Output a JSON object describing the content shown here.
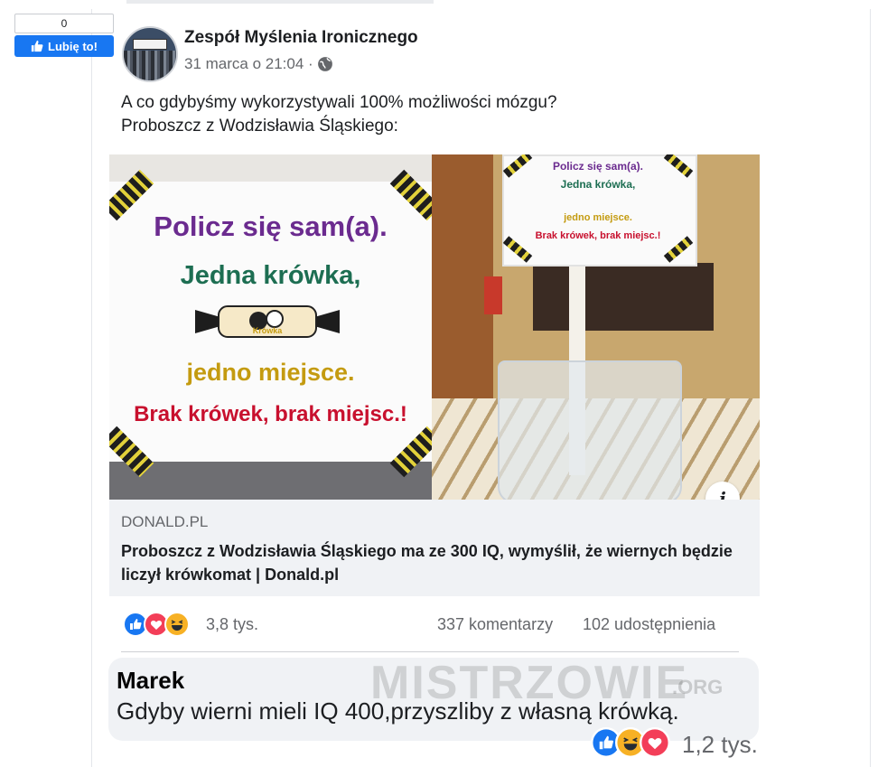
{
  "like_widget": {
    "count": "0",
    "label": "Lubię to!"
  },
  "post": {
    "author": "Zespół Myślenia Ironicznego",
    "timestamp": "31 marca o 21:04 ·",
    "text_line1": "A co gdybyśmy wykorzystywali 100% możliwości mózgu?",
    "text_line2": "Proboszcz z Wodzisławia Śląskiego:"
  },
  "image_left": {
    "line1": "Policz się sam(a).",
    "line2": "Jedna krówka,",
    "line3": "jedno miejsce.",
    "line4": "Brak krówek, brak miejsc.!",
    "candy_brand": "Krówka"
  },
  "image_right": {
    "line1": "Policz się sam(a).",
    "line2": "Jedna krówka,",
    "line3": "jedno miejsce.",
    "line4": "Brak krówek, brak miejsc.!"
  },
  "link": {
    "info": "i",
    "domain": "DONALD.PL",
    "title": "Proboszcz z Wodzisławia Śląskiego ma ze 300 IQ, wymyślił, że wiernych będzie liczył krówkomat | Donald.pl"
  },
  "stats": {
    "reactions": "3,8 tys.",
    "comments": "337 komentarzy",
    "shares": "102 udostępnienia"
  },
  "comment": {
    "author": "Marek",
    "text": "Gdyby wierni mieli IQ 400,przyszliby z własną krówką.",
    "reactions": "1,2 tys."
  },
  "watermark": {
    "text": "MISTRZOWIE",
    "suffix": ".ORG"
  },
  "colors": {
    "fb_blue": "#1877f2",
    "love_red": "#f33e58",
    "haha_yellow": "#f7b125",
    "purple_text": "#6b2b8f",
    "green_text": "#1d6e52",
    "mustard_text": "#c49b10",
    "red_text": "#c8102e"
  },
  "icons": [
    "like-thumb-icon",
    "globe-icon",
    "info-icon",
    "like-reaction-icon",
    "love-reaction-icon",
    "haha-reaction-icon"
  ]
}
